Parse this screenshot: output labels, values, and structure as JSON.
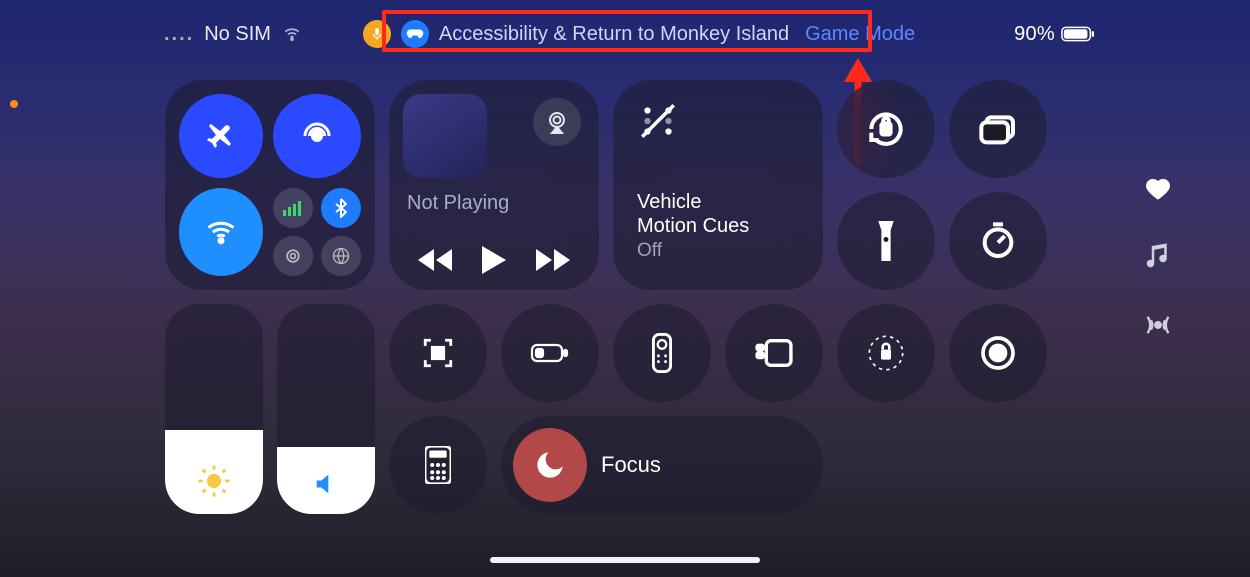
{
  "status_bar": {
    "carrier": "No SIM",
    "title": "Accessibility & Return to Monkey Island",
    "game_mode_label": "Game Mode",
    "battery_percent": "90%"
  },
  "media": {
    "now_playing_label": "Not Playing"
  },
  "vehicle_cues": {
    "line1": "Vehicle",
    "line2": "Motion Cues",
    "state": "Off"
  },
  "focus": {
    "label": "Focus"
  },
  "icons": {
    "mic": "mic",
    "gamepad": "gamepad",
    "wifi": "wifi",
    "airplane": "airplane",
    "airdrop": "airdrop",
    "cellular": "cellular",
    "bluetooth": "bluetooth",
    "hotspot": "hotspot",
    "vpn": "vpn"
  }
}
